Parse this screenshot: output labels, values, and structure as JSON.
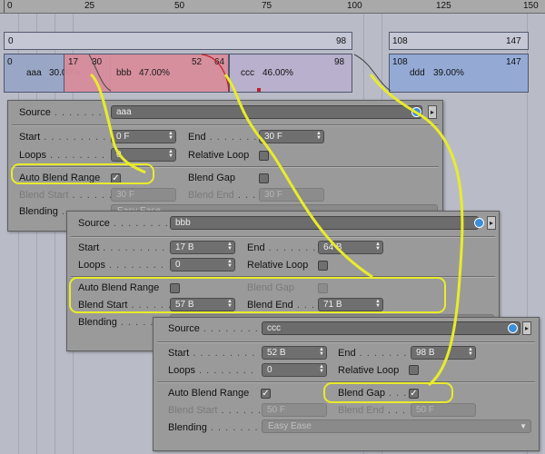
{
  "ruler": {
    "labels": [
      "0",
      "25",
      "50",
      "75",
      "100",
      "125",
      "150"
    ]
  },
  "tracks": {
    "row1": {
      "start_a": "0",
      "end_a": "98",
      "start_b": "108",
      "end_b": "147"
    },
    "row2": {
      "a": {
        "start": "0",
        "name": "aaa",
        "pct": "30.00%"
      },
      "b": {
        "start": "17",
        "end": "30",
        "name": "bbb",
        "pct": "47.00%",
        "num52": "52",
        "num64": "64"
      },
      "c": {
        "name": "ccc",
        "pct": "46.00%",
        "end": "98"
      },
      "d": {
        "start": "108",
        "name": "ddd",
        "pct": "39.00%",
        "end": "147"
      }
    }
  },
  "panel_a": {
    "source_label": "Source",
    "source_value": "aaa",
    "start_label": "Start",
    "start_value": "0 F",
    "end_label": "End",
    "end_value": "30 F",
    "loops_label": "Loops",
    "loops_value": "0",
    "relative_loop_label": "Relative Loop",
    "auto_blend_label": "Auto Blend Range",
    "auto_blend_checked": "✓",
    "blend_gap_label": "Blend Gap",
    "blend_start_label": "Blend Start",
    "blend_start_value": "30 F",
    "blend_end_label": "Blend End",
    "blend_end_value": "30 F",
    "blending_label": "Blending",
    "blending_value": "Easy Ease"
  },
  "panel_b": {
    "source_label": "Source",
    "source_value": "bbb",
    "start_label": "Start",
    "start_value": "17 B",
    "end_label": "End",
    "end_value": "64 B",
    "loops_label": "Loops",
    "loops_value": "0",
    "relative_loop_label": "Relative Loop",
    "auto_blend_label": "Auto Blend Range",
    "blend_gap_label": "Blend Gap",
    "blend_start_label": "Blend Start",
    "blend_start_value": "57 B",
    "blend_end_label": "Blend End",
    "blend_end_value": "71 B",
    "blending_label": "Blending"
  },
  "panel_c": {
    "source_label": "Source",
    "source_value": "ccc",
    "start_label": "Start",
    "start_value": "52 B",
    "end_label": "End",
    "end_value": "98 B",
    "loops_label": "Loops",
    "loops_value": "0",
    "relative_loop_label": "Relative Loop",
    "auto_blend_label": "Auto Blend Range",
    "auto_blend_checked": "✓",
    "blend_gap_label": "Blend Gap",
    "blend_gap_checked": "✓",
    "blend_start_label": "Blend Start",
    "blend_start_value": "50 F",
    "blend_end_label": "Blend End",
    "blend_end_value": "50 F",
    "blending_label": "Blending",
    "blending_value": "Easy Ease"
  },
  "colors": {
    "highlight": "#e8ec2a",
    "clip_a": "#9aa6c6",
    "clip_b": "#d88d9b",
    "clip_c": "#b8b0cc",
    "clip_d": "#94a9d4",
    "source_button": "#3a8fd8"
  },
  "icons": {
    "source_button": "link-icon",
    "source_arrow": "chevron-right-icon",
    "spin": "stepper-arrows-icon"
  }
}
